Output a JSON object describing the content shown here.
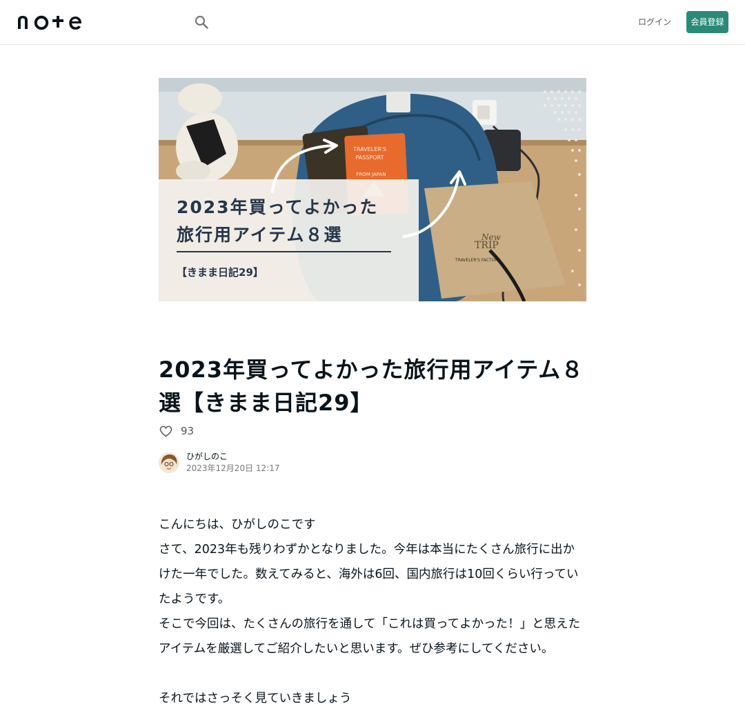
{
  "header": {
    "logo_text": "note",
    "login_label": "ログイン",
    "signup_label": "会員登録",
    "search_icon": "search-icon"
  },
  "hero": {
    "headline_line1": "2023年買ってよかった",
    "headline_line2": "旅行用アイテム８選",
    "subtitle": "【きまま日記29】",
    "passport_text_1": "TRAVELER'S",
    "passport_text_2": "PASSPORT",
    "passport_text_3": "FROM JAPAN",
    "bag_text_1": "New",
    "bag_text_2": "TRIP",
    "bag_text_3": "TRAVELER'S FACTORY"
  },
  "article": {
    "title": "2023年買ってよかった旅行用アイテム８選【きまま日記29】",
    "like_count": "93",
    "author_name": "ひがしのこ",
    "date": "2023年12月20日 12:17",
    "paragraphs": [
      "こんにちは、ひがしのこです",
      "さて、2023年も残りわずかとなりました。今年は本当にたくさん旅行に出かけた一年でした。数えてみると、海外は6回、国内旅行は10回くらい行っていたようです。",
      "そこで今回は、たくさんの旅行を通して「これは買ってよかった！」と思えたアイテムを厳選してご紹介したいと思います。ぜひ参考にしてください。",
      "",
      "それではさっそく見ていきましょう"
    ]
  }
}
